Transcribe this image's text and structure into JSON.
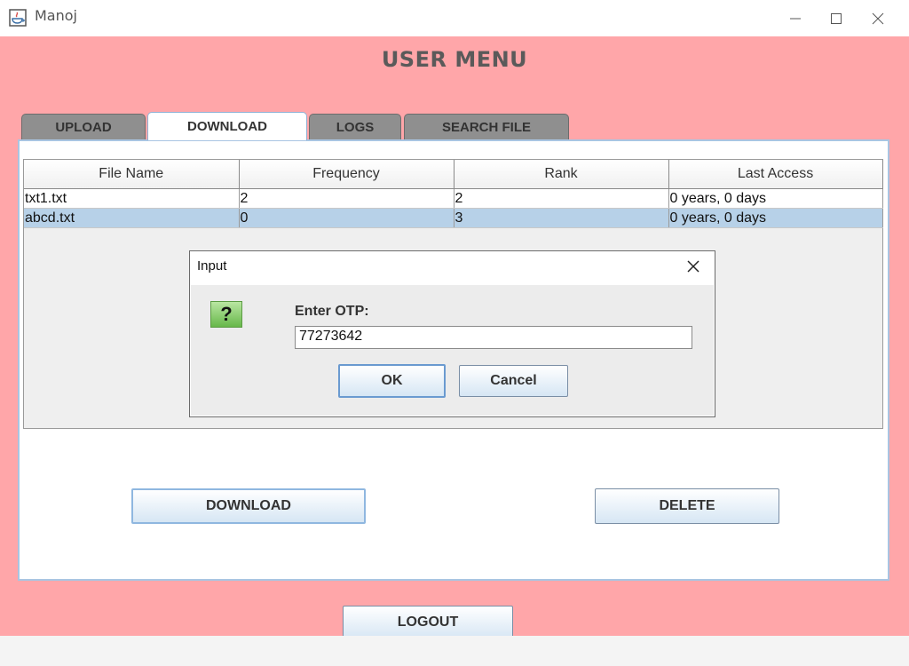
{
  "window": {
    "title": "Manoj"
  },
  "heading": "USER MENU",
  "tabs": [
    {
      "label": "UPLOAD"
    },
    {
      "label": "DOWNLOAD"
    },
    {
      "label": "LOGS"
    },
    {
      "label": "SEARCH FILE"
    }
  ],
  "table": {
    "columns": [
      "File Name",
      "Frequency",
      "Rank",
      "Last Access"
    ],
    "rows": [
      [
        "txt1.txt",
        "2",
        "2",
        "0 years, 0 days"
      ],
      [
        "abcd.txt",
        "0",
        "3",
        "0 years, 0 days"
      ]
    ]
  },
  "dialog": {
    "title": "Input",
    "prompt": "Enter OTP:",
    "value": "77273642",
    "ok_label": "OK",
    "cancel_label": "Cancel"
  },
  "buttons": {
    "download_label": "DOWNLOAD",
    "delete_label": "DELETE",
    "logout_label": "LOGOUT"
  },
  "colors": {
    "background": "#ffa6a9",
    "selected_row": "#b7d1e8",
    "active_tab_border": "#8fb2d6"
  }
}
